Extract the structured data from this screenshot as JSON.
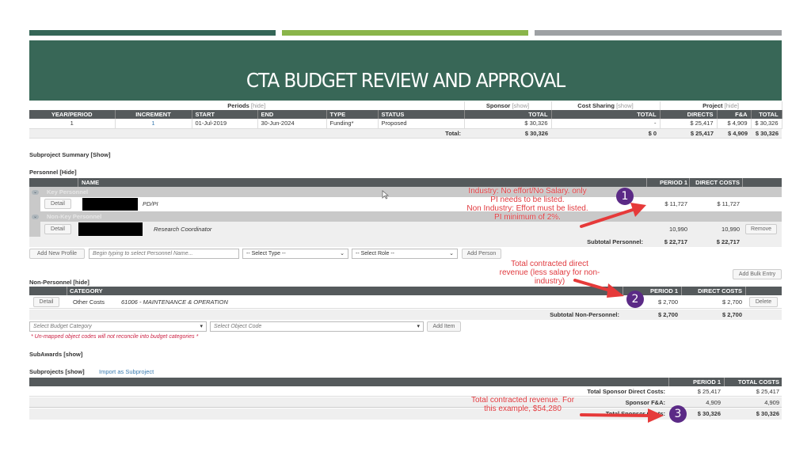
{
  "slide": {
    "title": "CTA BUDGET REVIEW AND APPROVAL",
    "accent_colors": {
      "dark_green": "#386757",
      "light_green": "#8ab54a",
      "gray": "#9ea1a4"
    }
  },
  "periods_table": {
    "groups": {
      "periods": {
        "label": "Periods",
        "toggle": "[hide]"
      },
      "sponsor": {
        "label": "Sponsor",
        "toggle": "[show]"
      },
      "cost_sharing": {
        "label": "Cost Sharing",
        "toggle": "[show]"
      },
      "project": {
        "label": "Project",
        "toggle": "[hide]"
      }
    },
    "headers": [
      "YEAR/PERIOD",
      "INCREMENT",
      "START",
      "END",
      "TYPE",
      "STATUS",
      "TOTAL",
      "TOTAL",
      "DIRECTS",
      "F&A",
      "TOTAL"
    ],
    "row": {
      "year_period": "1",
      "increment": "1",
      "start": "01-Jul-2019",
      "end": "30-Jun-2024",
      "type": "Funding*",
      "status": "Proposed",
      "sponsor_total": "$ 30,326",
      "cost_sharing_total": "-",
      "directs": "$ 25,417",
      "fa": "$ 4,909",
      "project_total": "$ 30,326"
    },
    "total_row": {
      "label": "Total:",
      "sponsor_total": "$ 30,326",
      "cost_sharing_total": "$ 0",
      "directs": "$ 25,417",
      "fa": "$ 4,909",
      "project_total": "$ 30,326"
    }
  },
  "subproject_summary": {
    "label": "Subproject Summary [Show]"
  },
  "personnel": {
    "label": "Personnel [Hide]",
    "headers": {
      "name": "NAME",
      "period1": "PERIOD 1",
      "direct_costs": "DIRECT COSTS"
    },
    "groups": [
      {
        "label": "Key Personnel",
        "rows": [
          {
            "detail": "Detail",
            "name_redacted": true,
            "role": "PD/PI",
            "period1": "$ 11,727",
            "direct_costs": "$ 11,727",
            "action": ""
          }
        ]
      },
      {
        "label": "Non-Key Personnel",
        "rows": [
          {
            "detail": "Detail",
            "name_redacted": true,
            "role": "Research Coordinator",
            "period1": "10,990",
            "direct_costs": "10,990",
            "action": "Remove"
          }
        ]
      }
    ],
    "subtotal": {
      "label": "Subtotal Personnel:",
      "period1": "$ 22,717",
      "direct_costs": "$ 22,717"
    },
    "controls": {
      "add_new_profile": "Add New Profile",
      "name_placeholder": "Begin typing to select Personnel Name...",
      "type_select": "-- Select Type --",
      "role_select": "-- Select Role --",
      "add_person": "Add Person"
    }
  },
  "non_personnel": {
    "label": "Non-Personnel [hide]",
    "add_bulk_entry": "Add Bulk Entry",
    "headers": {
      "category": "CATEGORY",
      "period1": "PERIOD 1",
      "direct_costs": "DIRECT COSTS"
    },
    "rows": [
      {
        "detail": "Detail",
        "category": "Other Costs",
        "object_code": "61006 - MAINTENANCE & OPERATION",
        "period1": "$ 2,700",
        "direct_costs": "$ 2,700",
        "action": "Delete"
      }
    ],
    "subtotal": {
      "label": "Subtotal Non-Personnel:",
      "period1": "$ 2,700",
      "direct_costs": "$ 2,700"
    },
    "controls": {
      "budget_category_placeholder": "Select Budget Category",
      "object_code_placeholder": "Select Object Code",
      "add_item": "Add Item"
    },
    "warning": "* Un-mapped object codes will not reconcile into budget categories *"
  },
  "subawards": {
    "label": "SubAwards [show]"
  },
  "subprojects": {
    "label": "Subprojects [show]",
    "import_link": "Import as Subproject",
    "headers": {
      "period1": "PERIOD 1",
      "total_costs": "TOTAL COSTS"
    },
    "rows": [
      {
        "label": "Total Sponsor Direct Costs:",
        "period1": "$ 25,417",
        "total_costs": "$ 25,417"
      },
      {
        "label": "Sponsor F&A:",
        "period1": "4,909",
        "total_costs": "4,909"
      },
      {
        "label": "Total Sponsor Costs:",
        "period1": "$ 30,326",
        "total_costs": "$ 30,326"
      }
    ]
  },
  "annotations": [
    {
      "number": "1",
      "text_lines": [
        "Industry:  No effort/No Salary.  only",
        "PI needs to be listed.",
        "Non Industry:  Effort must be listed.",
        "PI minimum of 2%."
      ]
    },
    {
      "number": "2",
      "text_lines": [
        "Total contracted direct",
        "revenue (less salary for non-",
        "industry)"
      ]
    },
    {
      "number": "3",
      "text_lines": [
        "Total contracted revenue.  For",
        "this example, $54,280"
      ]
    }
  ]
}
